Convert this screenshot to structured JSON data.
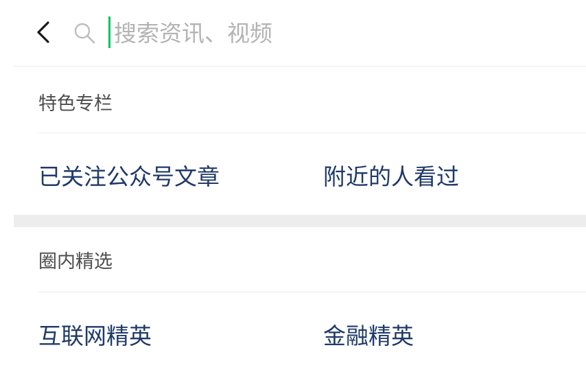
{
  "search": {
    "placeholder": "搜索资讯、视频",
    "value": ""
  },
  "icons": {
    "back": "chevron-left-icon",
    "search": "search-icon"
  },
  "colors": {
    "accent": "#07c160",
    "item_text": "#1f3a68",
    "section_title": "#4d4d4d",
    "placeholder": "#b3b3b3"
  },
  "sections": [
    {
      "title": "特色专栏",
      "items": [
        "已关注公众号文章",
        "附近的人看过"
      ]
    },
    {
      "title": "圈内精选",
      "items": [
        "互联网精英",
        "金融精英"
      ]
    }
  ]
}
